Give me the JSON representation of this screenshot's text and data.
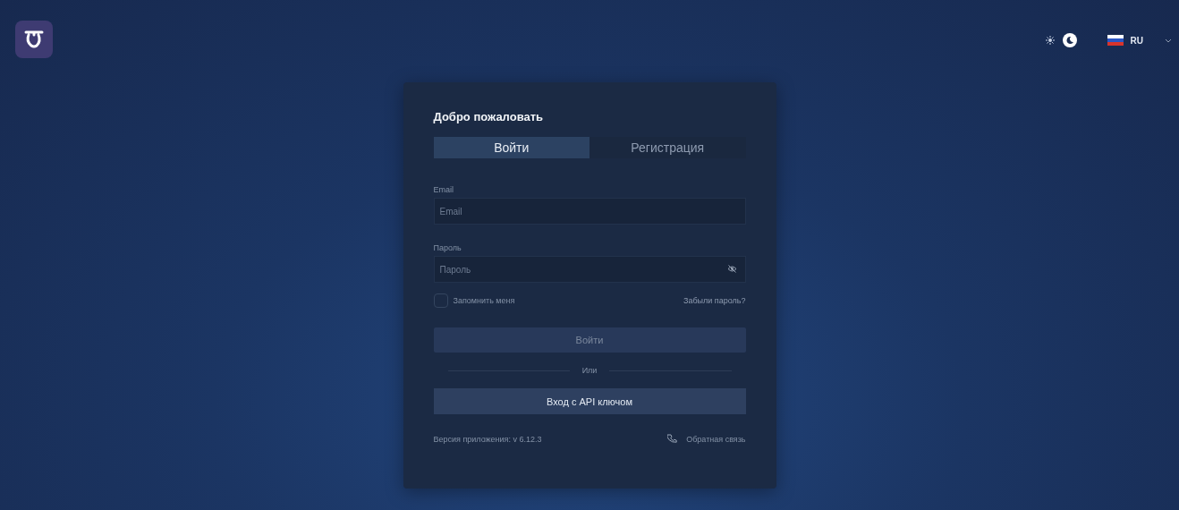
{
  "theme_toggle": [
    {
      "kind": "light",
      "selected": false
    },
    {
      "kind": "dark",
      "selected": true
    }
  ],
  "language": {
    "code": "RU"
  },
  "card": {
    "title": "Добро пожаловать",
    "tabs": [
      {
        "label": "Войти",
        "selected": true
      },
      {
        "label": "Регистрация",
        "selected": false
      }
    ],
    "fields": [
      {
        "kind": "text",
        "label": "Email",
        "placeholder": "Email"
      },
      {
        "kind": "password",
        "label": "Пароль",
        "placeholder": "Пароль"
      }
    ],
    "remember": {
      "label": "Запомнить меня",
      "checked": false
    },
    "forgot_link": "Забыли пароль?",
    "submit": {
      "label": "Войти",
      "disabled": true
    },
    "divider": "Или",
    "api_button": "Вход с API ключом",
    "version": "Версия приложения: v 6.12.3",
    "feedback_link": "Обратная связь"
  }
}
